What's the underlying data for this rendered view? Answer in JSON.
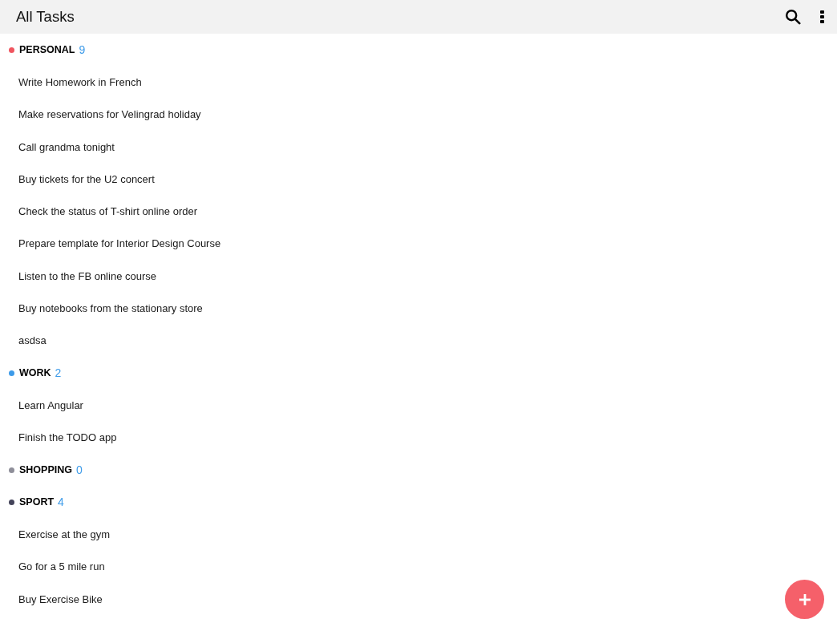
{
  "app_bar": {
    "title": "All Tasks"
  },
  "groups": [
    {
      "name": "PERSONAL",
      "count": "9",
      "color": "#f0555f",
      "tasks": [
        "Write Homework in French",
        "Make reservations for Velingrad holiday",
        "Call grandma tonight",
        "Buy tickets for the U2 concert",
        "Check the status of T-shirt online order",
        "Prepare template for Interior Design Course",
        "Listen to the FB online course",
        "Buy notebooks from the stationary store",
        "asdsa"
      ]
    },
    {
      "name": "WORK",
      "count": "2",
      "color": "#3d9be9",
      "tasks": [
        "Learn Angular",
        "Finish the TODO app"
      ]
    },
    {
      "name": "SHOPPING",
      "count": "0",
      "color": "#8e8e99"
    },
    {
      "name": "SPORT",
      "count": "4",
      "color": "#44445a",
      "tasks": [
        "Exercise at the gym",
        "Go for a 5 mile run",
        "Buy Exercise Bike"
      ]
    }
  ]
}
